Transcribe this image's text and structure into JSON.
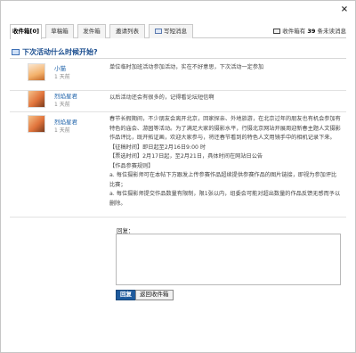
{
  "dialog": {
    "close_glyph": "×"
  },
  "tabs": [
    {
      "label": "收件箱[0]",
      "active": true
    },
    {
      "label": "草稿箱",
      "active": false
    },
    {
      "label": "发件箱",
      "active": false
    },
    {
      "label": "邀请列表",
      "active": false
    },
    {
      "label": "写短消息",
      "icon": "compose-icon",
      "active": false
    }
  ],
  "summary": {
    "prefix": "收件箱有",
    "count": "39",
    "suffix": "条未读消息",
    "icon": "mail-icon"
  },
  "topic": {
    "title": "下次活动什么时候开始?",
    "icon": "message-icon"
  },
  "messages": [
    {
      "name": "小猫",
      "time": "1 天前",
      "paragraphs": [
        "单位临时加班活动参加活动，实在不好意思，下次活动一定参加"
      ]
    },
    {
      "name": "烈焰星君",
      "time": "1 天前",
      "paragraphs": [
        "以后活动还会有很多的，记得看论坛短信啊"
      ]
    },
    {
      "name": "烈焰星君",
      "time": "1 天前",
      "paragraphs": [
        "春节长假期间，不少朋友会离开北京，回家探亲、外地旅游，在北京过年的朋友也有机会参加有特色的庙会、游园等活动。为了满足大家的摄影水平，行摄北京网站开展周迎新春主题人文摄影作品评比，既开拓证画，欢迎大家参与，将还春节看到的特色人文用镜手中的相机记录下来。",
        "【征稿时间】即日起至2月16日9:00 时",
        "【票选时间】2月17日起，至2月21日，具体时间在网站日公告",
        "【作品参赛规则】",
        "a. 每位摄影师可在本帖下方跟发上传参赛作品超续提供参赛作品的图片链接，即视为参加评比比赛；",
        "a. 每位摄影师提交作品数量有限制，限1张以内，组委会可能对超出数量的作品反馈无感而予以删除。"
      ]
    }
  ],
  "reply": {
    "label": "回复：",
    "placeholder": ""
  },
  "buttons": {
    "reply": "回复",
    "back": "返回收件箱"
  }
}
